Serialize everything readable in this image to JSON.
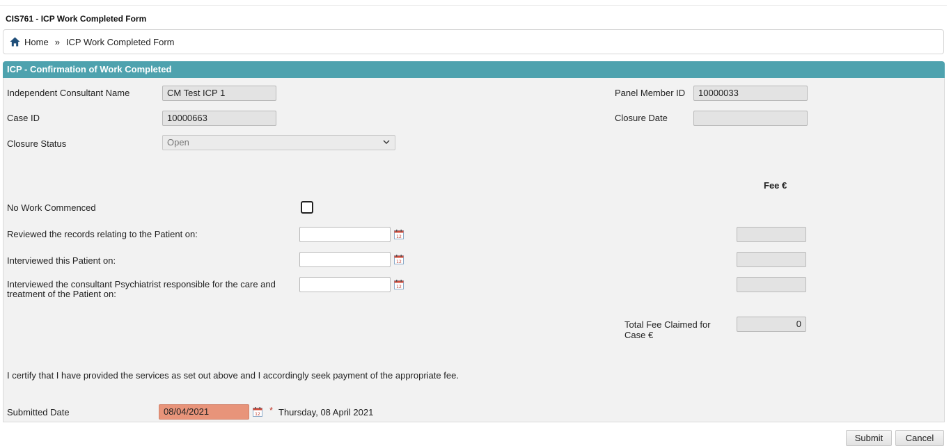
{
  "page": {
    "title": "CIS761 - ICP Work Completed Form"
  },
  "breadcrumb": {
    "home": "Home",
    "separator": "»",
    "current": "ICP Work Completed Form"
  },
  "section": {
    "title": "ICP - Confirmation of Work Completed"
  },
  "fields": {
    "consultant_name_label": "Independent Consultant Name",
    "consultant_name_value": "CM Test ICP 1",
    "panel_member_label": "Panel Member ID",
    "panel_member_value": "10000033",
    "case_id_label": "Case ID",
    "case_id_value": "10000663",
    "closure_date_label": "Closure Date",
    "closure_date_value": "",
    "closure_status_label": "Closure Status",
    "closure_status_value": "Open"
  },
  "fee_header": "Fee €",
  "work_items": {
    "no_work_label": "No Work Commenced",
    "no_work_checked": false,
    "reviewed_label": "Reviewed the records relating to the Patient on:",
    "reviewed_date": "",
    "reviewed_fee": "",
    "interviewed_patient_label": "Interviewed this Patient on:",
    "interviewed_patient_date": "",
    "interviewed_patient_fee": "",
    "interviewed_psychiatrist_label": "Interviewed the consultant Psychiatrist responsible for the care and treatment of the Patient on:",
    "interviewed_psychiatrist_date": "",
    "interviewed_psychiatrist_fee": ""
  },
  "total": {
    "label": "Total Fee Claimed for Case €",
    "value": "0"
  },
  "certification": "I certify that I have provided the services as set out above and I accordingly seek payment of the appropriate fee.",
  "submitted": {
    "label": "Submitted Date",
    "value": "08/04/2021",
    "required_marker": "*",
    "long_date": "Thursday, 08 April 2021"
  },
  "buttons": {
    "submit": "Submit",
    "cancel": "Cancel"
  },
  "colors": {
    "header": "#4ea2ae",
    "required_field": "#e8947a",
    "home_icon": "#1f4e79"
  },
  "icons": {
    "home": "home-icon",
    "calendar": "calendar-icon",
    "dropdown": "chevron-down-icon"
  }
}
